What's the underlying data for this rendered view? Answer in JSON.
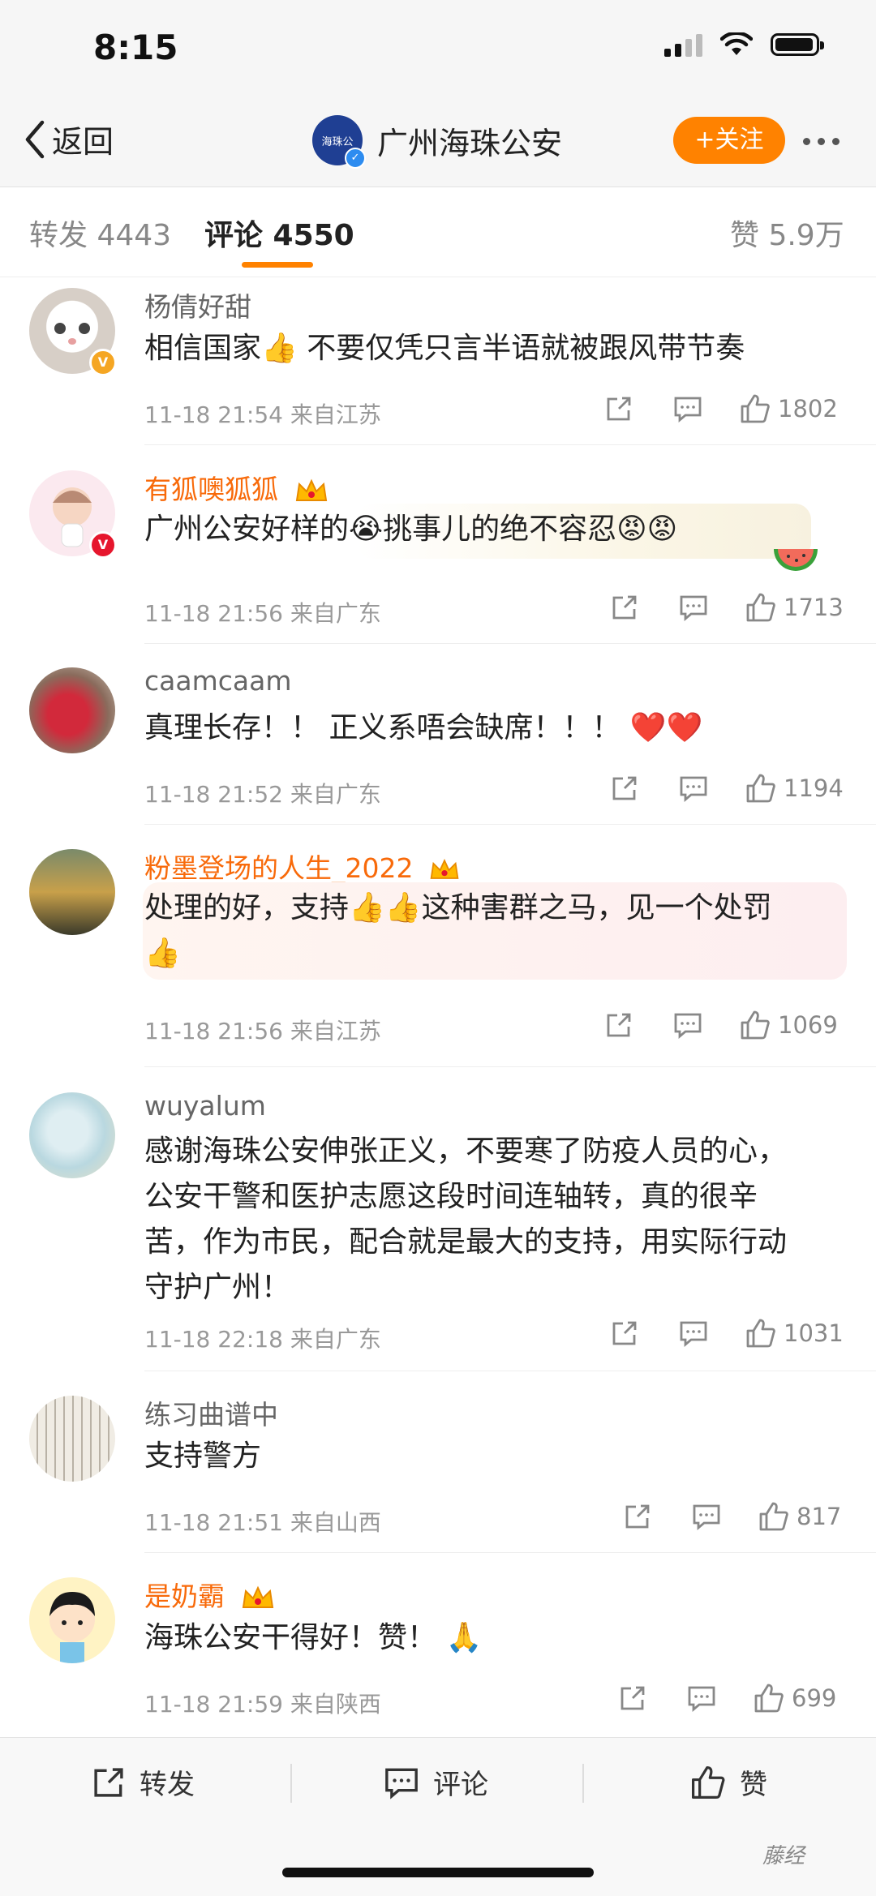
{
  "status_bar": {
    "time": "8:15"
  },
  "nav": {
    "back_label": "返回",
    "title": "广州海珠公安",
    "avatar_text": "海珠公",
    "follow_label": "+关注"
  },
  "tabs": {
    "repost": "转发 4443",
    "comment": "评论 4550",
    "like": "赞 5.9万"
  },
  "comments": [
    {
      "user": "杨倩好甜",
      "text": "相信国家👍 不要仅凭只言半语就被跟风带节奏",
      "time": "11-18 21:54",
      "source": "来自江苏",
      "likes": "1802"
    },
    {
      "user": "有狐噢狐狐",
      "text": "广州公安好样的😭挑事儿的绝不容忍😡😡",
      "time": "11-18 21:56",
      "source": "来自广东",
      "likes": "1713"
    },
    {
      "user": "caamcaam",
      "text": "真理长存！！ 正义系唔会缺席！！！ ❤️❤️",
      "time": "11-18 21:52",
      "source": "来自广东",
      "likes": "1194"
    },
    {
      "user": "粉墨登场的人生_2022",
      "text_line1": "处理的好，支持👍👍这种害群之马，见一个处罚",
      "text_line2": "👍",
      "time": "11-18 21:56",
      "source": "来自江苏",
      "likes": "1069"
    },
    {
      "user": "wuyalum",
      "text_lines": [
        "感谢海珠公安伸张正义，不要寒了防疫人员的心，",
        "公安干警和医护志愿这段时间连轴转，真的很辛",
        "苦，作为市民，配合就是最大的支持，用实际行动",
        "守护广州！"
      ],
      "time": "11-18 22:18",
      "source": "来自广东",
      "likes": "1031"
    },
    {
      "user": "练习曲谱中",
      "text": "支持警方",
      "time": "11-18 21:51",
      "source": "来自山西",
      "likes": "817"
    },
    {
      "user": "是奶霸",
      "text": "海珠公安干得好！赞！ 🙏",
      "time": "11-18 21:59",
      "source": "来自陕西",
      "likes": "699"
    }
  ],
  "toolbar": {
    "repost": "转发",
    "comment": "评论",
    "like": "赞"
  },
  "watermark": "藤经",
  "colors": {
    "accent": "#ff8200",
    "vip_name": "#f86a0a"
  }
}
